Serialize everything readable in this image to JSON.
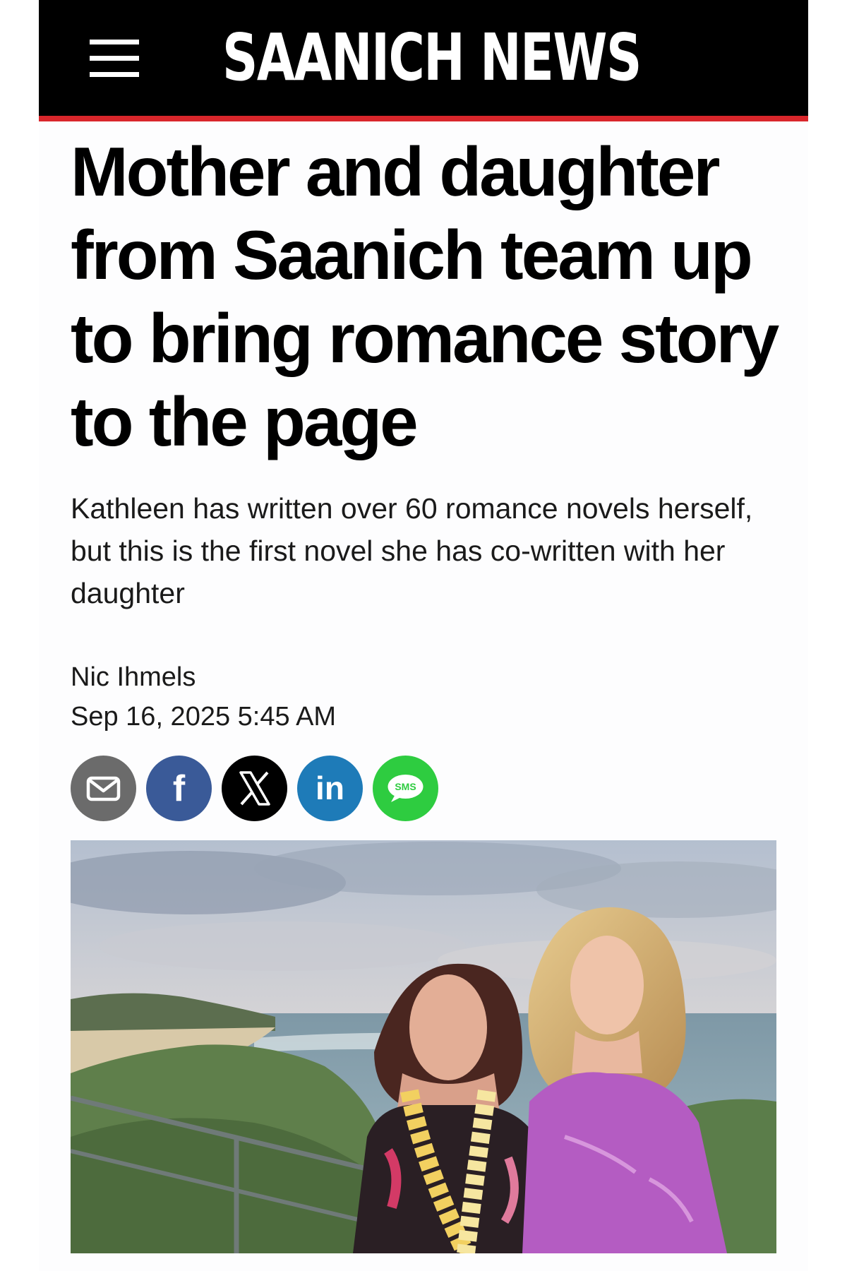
{
  "header": {
    "logo_text": "SAANICH NEWS",
    "menu_icon": "hamburger-menu-icon",
    "background_color": "#000000",
    "accent_color": "#d9262b"
  },
  "article": {
    "headline": "Mother and daughter from Saanich team up to bring romance story to the page",
    "subheadline": "Kathleen has written over 60 romance novels herself, but this is the first novel she has co-written with her daughter",
    "author": "Nic Ihmels",
    "date": "Sep 16, 2025 5:45 AM"
  },
  "share": {
    "buttons": [
      {
        "name": "email",
        "icon": "envelope-icon",
        "color": "#6b6b6b"
      },
      {
        "name": "facebook",
        "icon": "facebook-icon",
        "label": "f",
        "color": "#3a5a98"
      },
      {
        "name": "x",
        "icon": "x-logo-icon",
        "color": "#000000"
      },
      {
        "name": "linkedin",
        "icon": "linkedin-icon",
        "label": "in",
        "color": "#1e7bb8"
      },
      {
        "name": "sms",
        "icon": "sms-bubble-icon",
        "label": "SMS",
        "color": "#2ecc40"
      }
    ]
  },
  "photo": {
    "icon": "article-photo-two-women-at-beach"
  }
}
